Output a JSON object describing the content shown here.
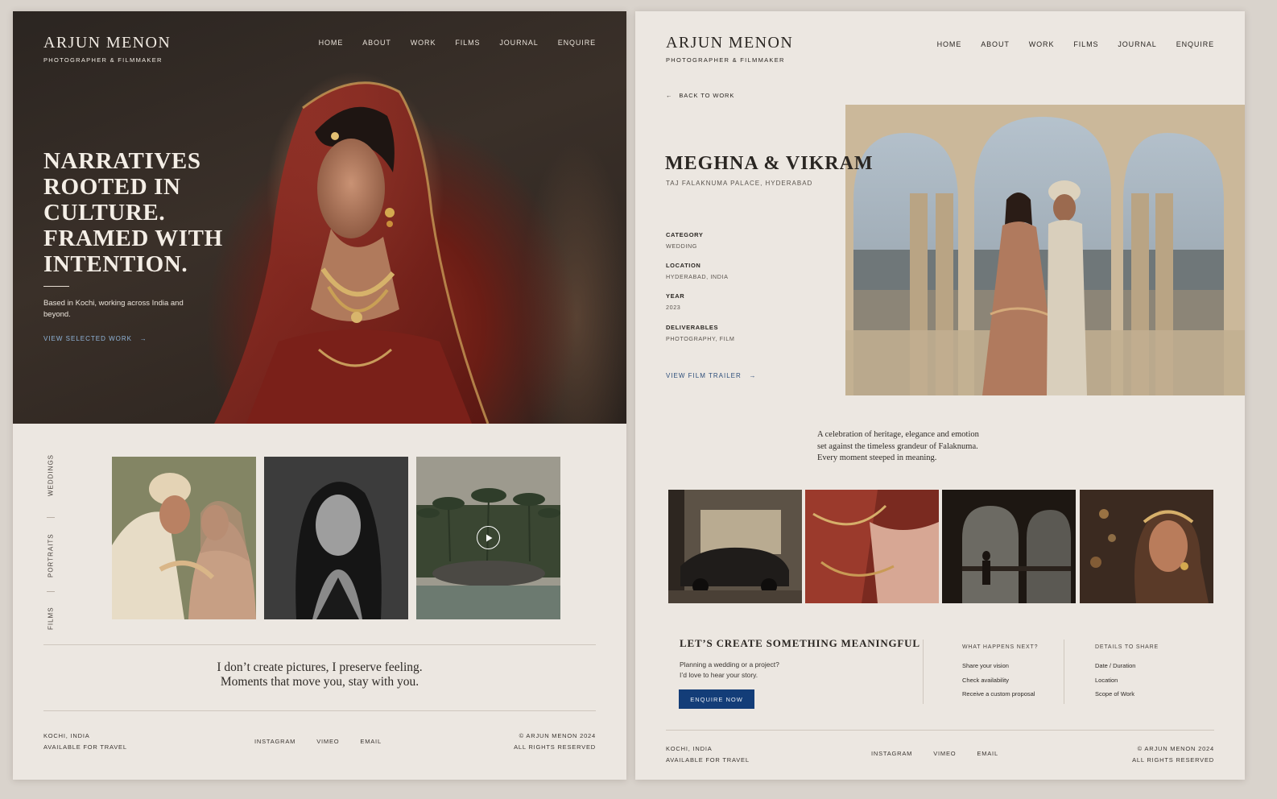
{
  "brand": {
    "name": "ARJUN MENON",
    "tagline": "PHOTOGRAPHER & FILMMAKER"
  },
  "nav": [
    "HOME",
    "ABOUT",
    "WORK",
    "FILMS",
    "JOURNAL",
    "ENQUIRE"
  ],
  "home": {
    "hero": {
      "title_lines": [
        "NARRATIVES",
        "ROOTED IN",
        "CULTURE.",
        "FRAMED WITH",
        "INTENTION."
      ],
      "text": "Based in Kochi, working across India and beyond.",
      "cta": "VIEW SELECTED WORK",
      "cta_arrow": "→"
    },
    "tabs": [
      "WEDDINGS",
      "PORTRAITS",
      "FILMS"
    ],
    "thumbs": [
      "wedding-couple-photo",
      "portrait-photo",
      "film-palms-photo"
    ],
    "quote_lines": [
      "I don’t create pictures, I preserve feeling.",
      "Moments that move you, stay with you."
    ],
    "footer": {
      "location": "KOCHI, INDIA",
      "travel": "AVAILABLE FOR TRAVEL",
      "links": [
        "INSTAGRAM",
        "VIMEO",
        "EMAIL"
      ],
      "copyright": "© ARJUN MENON 2024",
      "rights": "ALL RIGHTS RESERVED"
    }
  },
  "project": {
    "back": "BACK TO WORK",
    "back_arrow": "←",
    "title": "MEGHNA & VIKRAM",
    "location": "TAJ FALAKNUMA PALACE, HYDERABAD",
    "meta": [
      {
        "label": "CATEGORY",
        "value": "WEDDING"
      },
      {
        "label": "LOCATION",
        "value": "HYDERABAD, INDIA"
      },
      {
        "label": "YEAR",
        "value": "2023"
      },
      {
        "label": "DELIVERABLES",
        "value": "PHOTOGRAPHY, FILM"
      }
    ],
    "trailer": "VIEW FILM TRAILER",
    "trailer_arrow": "→",
    "description_lines": [
      "A celebration of heritage, elegance and emotion",
      "set against the timeless grandeur of Falaknuma.",
      "Every moment steeped in meaning."
    ],
    "gallery": [
      "vintage-car-photo",
      "bridal-details-photo",
      "arches-silhouette-photo",
      "bride-portrait-photo"
    ],
    "cta": {
      "title": "LET’S CREATE SOMETHING MEANINGFUL",
      "text_lines": [
        "Planning a wedding or a project?",
        "I’d love to hear your story."
      ],
      "button": "ENQUIRE NOW"
    },
    "next": {
      "heading": "WHAT HAPPENS NEXT?",
      "items": [
        "Share your vision",
        "Check availability",
        "Receive a custom proposal"
      ]
    },
    "share": {
      "heading": "DETAILS TO SHARE",
      "items": [
        "Date / Duration",
        "Location",
        "Scope of Work"
      ]
    },
    "footer": {
      "location": "KOCHI, INDIA",
      "travel": "AVAILABLE FOR TRAVEL",
      "links": [
        "INSTAGRAM",
        "VIMEO",
        "EMAIL"
      ],
      "copyright": "© ARJUN MENON 2024",
      "rights": "ALL RIGHTS RESERVED"
    }
  },
  "colors": {
    "background": "#ece7e1",
    "hero_dark": "#2b2521",
    "accent_blue": "#133d78",
    "link_blue": "#8fb4d9",
    "bridal_red": "#8e2a1e"
  }
}
